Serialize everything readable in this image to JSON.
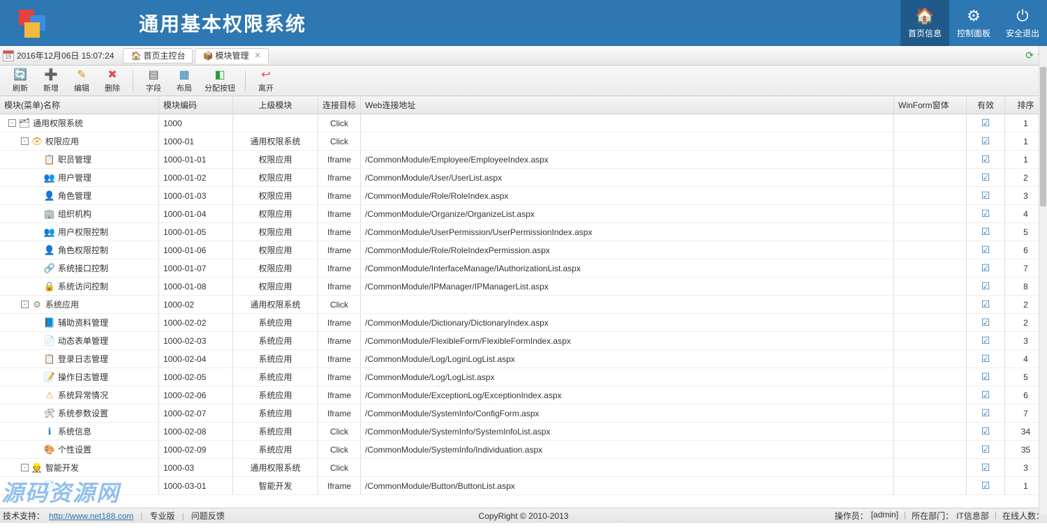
{
  "header": {
    "app_title": "通用基本权限系统",
    "nav": [
      {
        "label": "首页信息",
        "icon": "🏠",
        "active": true
      },
      {
        "label": "控制面板",
        "icon": "⚙",
        "active": false
      },
      {
        "label": "安全退出",
        "icon": "⏻",
        "active": false
      }
    ]
  },
  "tabbar": {
    "datetime": "2016年12月06日 15:07:24",
    "calendar_day": "15",
    "tabs": [
      {
        "label": "首页主控台",
        "icon": "🏠",
        "closable": false,
        "active": false
      },
      {
        "label": "模块管理",
        "icon": "📦",
        "closable": true,
        "active": true
      }
    ]
  },
  "toolbar": {
    "buttons": [
      {
        "label": "刷新",
        "icon": "🔄",
        "color": "#2a9d3a"
      },
      {
        "label": "新增",
        "icon": "➕",
        "color": "#2a9d3a"
      },
      {
        "label": "编辑",
        "icon": "✎",
        "color": "#d98c2a"
      },
      {
        "label": "删除",
        "icon": "✖",
        "color": "#d9534f"
      },
      {
        "sep": true
      },
      {
        "label": "字段",
        "icon": "▤",
        "color": "#555"
      },
      {
        "label": "布局",
        "icon": "▦",
        "color": "#2a7db3"
      },
      {
        "label": "分配按钮",
        "icon": "◧",
        "color": "#2a9d3a",
        "wide": true
      },
      {
        "sep": true
      },
      {
        "label": "离开",
        "icon": "↩",
        "color": "#d9534f"
      }
    ]
  },
  "grid": {
    "columns": {
      "name": "模块(菜单)名称",
      "code": "模块编码",
      "parent": "上级模块",
      "target": "连接目标",
      "url": "Web连接地址",
      "winform": "WinForm窗体",
      "valid": "有效",
      "sort": "排序"
    },
    "rows": [
      {
        "level": 0,
        "expand": "-",
        "icon": "🗂",
        "name": "通用权限系统",
        "code": "1000",
        "parent": "",
        "target": "Click",
        "url": "",
        "valid": true,
        "sort": 1
      },
      {
        "level": 1,
        "expand": "-",
        "icon": "👁",
        "iconColor": "#e8a33a",
        "name": "权限应用",
        "code": "1000-01",
        "parent": "通用权限系统",
        "target": "Click",
        "url": "",
        "valid": true,
        "sort": 1
      },
      {
        "level": 2,
        "icon": "📋",
        "name": "职员管理",
        "code": "1000-01-01",
        "parent": "权限应用",
        "target": "Iframe",
        "url": "/CommonModule/Employee/EmployeeIndex.aspx",
        "valid": true,
        "sort": 1
      },
      {
        "level": 2,
        "icon": "👥",
        "name": "用户管理",
        "code": "1000-01-02",
        "parent": "权限应用",
        "target": "Iframe",
        "url": "/CommonModule/User/UserList.aspx",
        "valid": true,
        "sort": 2
      },
      {
        "level": 2,
        "icon": "👤",
        "iconColor": "#e8a33a",
        "name": "角色管理",
        "code": "1000-01-03",
        "parent": "权限应用",
        "target": "Iframe",
        "url": "/CommonModule/Role/RoleIndex.aspx",
        "valid": true,
        "sort": 3
      },
      {
        "level": 2,
        "icon": "🏢",
        "name": "组织机构",
        "code": "1000-01-04",
        "parent": "权限应用",
        "target": "Iframe",
        "url": "/CommonModule/Organize/OrganizeList.aspx",
        "valid": true,
        "sort": 4
      },
      {
        "level": 2,
        "icon": "👥",
        "name": "用户权限控制",
        "code": "1000-01-05",
        "parent": "权限应用",
        "target": "Iframe",
        "url": "/CommonModule/UserPermission/UserPermissionIndex.aspx",
        "valid": true,
        "sort": 5
      },
      {
        "level": 2,
        "icon": "👤",
        "iconColor": "#e8a33a",
        "name": "角色权限控制",
        "code": "1000-01-06",
        "parent": "权限应用",
        "target": "Iframe",
        "url": "/CommonModule/Role/RoleIndexPermission.aspx",
        "valid": true,
        "sort": 6
      },
      {
        "level": 2,
        "icon": "🔗",
        "name": "系统接口控制",
        "code": "1000-01-07",
        "parent": "权限应用",
        "target": "Iframe",
        "url": "/CommonModule/InterfaceManage/IAuthorizationList.aspx",
        "valid": true,
        "sort": 7
      },
      {
        "level": 2,
        "icon": "🔒",
        "name": "系统访问控制",
        "code": "1000-01-08",
        "parent": "权限应用",
        "target": "Iframe",
        "url": "/CommonModule/IPManager/IPManagerList.aspx",
        "valid": true,
        "sort": 8
      },
      {
        "level": 1,
        "expand": "-",
        "icon": "⚙",
        "iconColor": "#888",
        "name": "系统应用",
        "code": "1000-02",
        "parent": "通用权限系统",
        "target": "Click",
        "url": "",
        "valid": true,
        "sort": 2
      },
      {
        "level": 2,
        "icon": "📘",
        "name": "辅助资料管理",
        "code": "1000-02-02",
        "parent": "系统应用",
        "target": "Iframe",
        "url": "/CommonModule/Dictionary/DictionaryIndex.aspx",
        "valid": true,
        "sort": 2
      },
      {
        "level": 2,
        "icon": "📄",
        "name": "动态表单管理",
        "code": "1000-02-03",
        "parent": "系统应用",
        "target": "Iframe",
        "url": "/CommonModule/FlexibleForm/FlexibleFormIndex.aspx",
        "valid": true,
        "sort": 3
      },
      {
        "level": 2,
        "icon": "📋",
        "name": "登录日志管理",
        "code": "1000-02-04",
        "parent": "系统应用",
        "target": "Iframe",
        "url": "/CommonModule/Log/LoginLogList.aspx",
        "valid": true,
        "sort": 4
      },
      {
        "level": 2,
        "icon": "📝",
        "name": "操作日志管理",
        "code": "1000-02-05",
        "parent": "系统应用",
        "target": "Iframe",
        "url": "/CommonModule/Log/LogList.aspx",
        "valid": true,
        "sort": 5
      },
      {
        "level": 2,
        "icon": "⚠",
        "iconColor": "#e8a33a",
        "name": "系统异常情况",
        "code": "1000-02-06",
        "parent": "系统应用",
        "target": "Iframe",
        "url": "/CommonModule/ExceptionLog/ExceptionIndex.aspx",
        "valid": true,
        "sort": 6
      },
      {
        "level": 2,
        "icon": "🛠",
        "name": "系统参数设置",
        "code": "1000-02-07",
        "parent": "系统应用",
        "target": "Iframe",
        "url": "/CommonModule/SystemInfo/ConfigForm.aspx",
        "valid": true,
        "sort": 7
      },
      {
        "level": 2,
        "icon": "ℹ",
        "iconColor": "#2d77b3",
        "name": "系统信息",
        "code": "1000-02-08",
        "parent": "系统应用",
        "target": "Click",
        "url": "/CommonModule/SystemInfo/SystemInfoList.aspx",
        "valid": true,
        "sort": 34
      },
      {
        "level": 2,
        "icon": "🎨",
        "name": "个性设置",
        "code": "1000-02-09",
        "parent": "系统应用",
        "target": "Click",
        "url": "/CommonModule/SystemInfo/Individuation.aspx",
        "valid": true,
        "sort": 35
      },
      {
        "level": 1,
        "expand": "-",
        "icon": "👷",
        "name": "智能开发",
        "code": "1000-03",
        "parent": "通用权限系统",
        "target": "Click",
        "url": "",
        "valid": true,
        "sort": 3
      },
      {
        "level": 2,
        "icon": "📄",
        "name": "",
        "code": "1000-03-01",
        "parent": "智能开发",
        "target": "Iframe",
        "url": "/CommonModule/Button/ButtonList.aspx",
        "valid": true,
        "sort": 1
      }
    ]
  },
  "footer": {
    "tech_support": "技术支持：",
    "tech_url": "http://www.net188.com",
    "pro": "专业版",
    "feedback": "问题反馈",
    "copyright": "CopyRight © 2010-2013",
    "operator_label": "操作员：",
    "operator_value": "[admin]",
    "dept_label": "所在部门：",
    "dept_value": "IT信息部",
    "online_label": "在线人数："
  },
  "watermark": "源码资源网"
}
